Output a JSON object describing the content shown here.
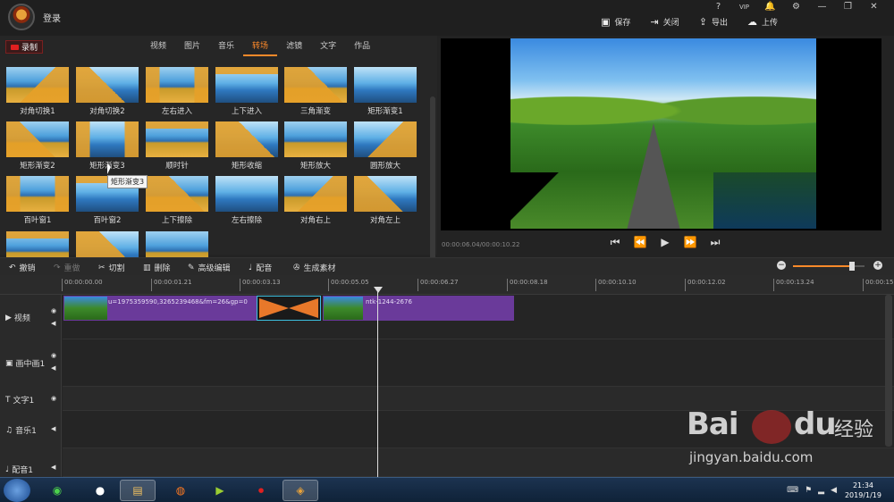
{
  "titlebar": {
    "login": "登录",
    "actions": [
      {
        "name": "save",
        "label": "保存",
        "icon": "floppy-icon"
      },
      {
        "name": "close",
        "label": "关闭",
        "icon": "exit-icon"
      },
      {
        "name": "export",
        "label": "导出",
        "icon": "share-icon"
      },
      {
        "name": "upload",
        "label": "上传",
        "icon": "cloud-upload-icon"
      }
    ],
    "window_ctrls": [
      "?",
      "VIP",
      "🔔",
      "⚙",
      "—",
      "❐",
      "✕"
    ]
  },
  "left": {
    "record_label": "录制",
    "tabs": [
      "视频",
      "图片",
      "音乐",
      "转场",
      "滤镜",
      "文字",
      "作品"
    ],
    "active_tab": "转场",
    "transitions": [
      "对角切换1",
      "对角切换2",
      "左右进入",
      "上下进入",
      "三角渐变",
      "矩形渐变1",
      "矩形渐变2",
      "矩形渐变3",
      "顺时针",
      "矩形收缩",
      "矩形放大",
      "圆形放大",
      "百叶窗1",
      "百叶窗2",
      "上下擦除",
      "左右擦除",
      "对角右上",
      "对角左上",
      "",
      "",
      ""
    ],
    "tooltip": "矩形渐变3"
  },
  "preview": {
    "time": "00:00:06.04/00:00:10.22",
    "controls": [
      "⏮",
      "⏪",
      "▶",
      "⏩",
      "⏭"
    ]
  },
  "toolbar": {
    "items": [
      {
        "label": "撤销",
        "icon": "undo-icon",
        "enabled": true
      },
      {
        "label": "重做",
        "icon": "redo-icon",
        "enabled": false
      },
      {
        "label": "切割",
        "icon": "scissors-icon",
        "enabled": true
      },
      {
        "label": "删除",
        "icon": "trash-icon",
        "enabled": true
      },
      {
        "label": "高级编辑",
        "icon": "pencil-icon",
        "enabled": true
      },
      {
        "label": "配音",
        "icon": "microphone-icon",
        "enabled": true
      },
      {
        "label": "生成素材",
        "icon": "film-reel-icon",
        "enabled": true
      }
    ],
    "zoom_minus": "−",
    "zoom_plus": "+",
    "zoom_level": 0.82
  },
  "timeline": {
    "ticks": [
      "00:00:00.00",
      "00:00:01.21",
      "00:00:03.13",
      "00:00:05.05",
      "00:00:06.27",
      "00:00:08.18",
      "00:00:10.10",
      "00:00:12.02",
      "00:00:13.24",
      "00:00:15."
    ],
    "tracks": [
      {
        "name": "视频",
        "icon": "video-track-icon"
      },
      {
        "name": "画中画1",
        "icon": "pip-track-icon"
      },
      {
        "name": "文字1",
        "icon": "text-track-icon"
      },
      {
        "name": "音乐1",
        "icon": "music-note-icon"
      },
      {
        "name": "配音1",
        "icon": "microphone-icon"
      }
    ],
    "clip1_text": "u=1975359590,3265239468&fm=26&gp=0",
    "clip2_text": "ntk-1244-2676"
  },
  "taskbar": {
    "time": "21:34",
    "date": "2019/1/19"
  },
  "watermark": {
    "brand": "Bai",
    "brand2": "du",
    "cn": "经验",
    "url": "jingyan.baidu.com"
  }
}
